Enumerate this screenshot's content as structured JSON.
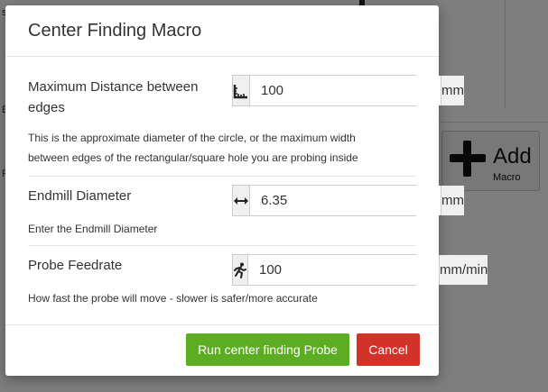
{
  "background": {
    "add_macro_label": "Add",
    "add_macro_sub": "Macro",
    "edge_letters": [
      "s",
      "E",
      "F"
    ]
  },
  "modal": {
    "title": "Center Finding Macro",
    "fields": [
      {
        "label": "Maximum Distance between edges",
        "label_line1": "Maximum Distance between",
        "label_line2": "edges",
        "value": "100",
        "unit": "mm",
        "icon": "ruler-icon",
        "help_line1": "This is the approximate diameter of the circle, or the maximum width",
        "help_line2": "between edges of the rectangular/square hole you are probing inside"
      },
      {
        "label": "Endmill Diameter",
        "value": "6.35",
        "unit": "mm",
        "icon": "arrows-horizontal-icon",
        "help": "Enter the Endmill Diameter"
      },
      {
        "label": "Probe Feedrate",
        "value": "100",
        "unit": "mm/min",
        "icon": "running-icon",
        "help": "How fast the probe will move - slower is safer/more accurate"
      }
    ],
    "buttons": {
      "run": "Run center finding Probe",
      "cancel": "Cancel"
    }
  },
  "colors": {
    "run_button": "#5cad22",
    "cancel_button": "#d33229"
  }
}
